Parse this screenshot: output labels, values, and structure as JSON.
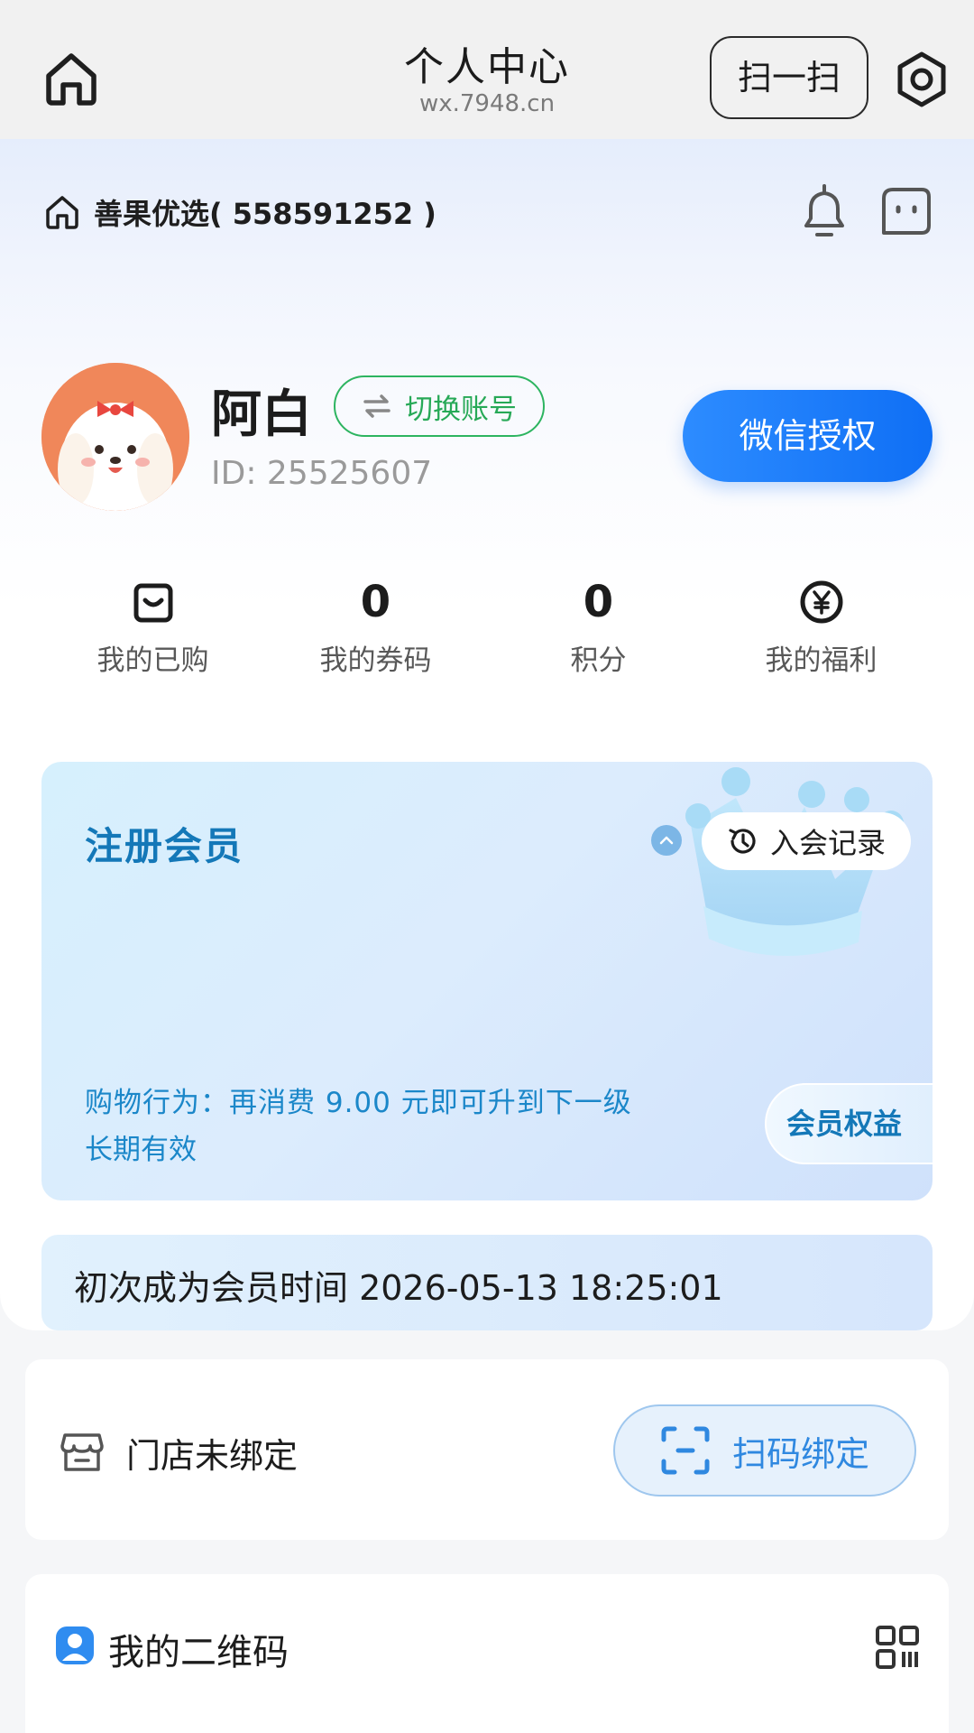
{
  "header": {
    "title": "个人中心",
    "subtitle": "wx.7948.cn",
    "scan_label": "扫一扫"
  },
  "store": {
    "name": "善果优选( 558591252 )"
  },
  "profile": {
    "username": "阿白",
    "switch_label": "切换账号",
    "user_id": "ID: 25525607",
    "wechat_auth_label": "微信授权"
  },
  "stats": {
    "items": [
      {
        "value": "",
        "label": "我的已购",
        "icon": "shopping-bag-icon"
      },
      {
        "value": "0",
        "label": "我的券码"
      },
      {
        "value": "0",
        "label": "积分"
      },
      {
        "value": "",
        "label": "我的福利",
        "icon": "yen-coin-icon"
      }
    ]
  },
  "member_card": {
    "title": "注册会员",
    "record_label": "入会记录",
    "line1": "购物行为：再消费 9.00 元即可升到下一级",
    "line2": "长期有效",
    "benefits_label": "会员权益"
  },
  "first_member": {
    "text": "初次成为会员时间 2026-05-13 18:25:01"
  },
  "store_binding": {
    "status_label": "门店未绑定",
    "scan_bind_label": "扫码绑定"
  },
  "qr_section": {
    "label": "我的二维码"
  },
  "colors": {
    "accent_blue": "#1478b8",
    "wechat_btn": "#1677ff",
    "switch_green": "#27a957",
    "bind_blue": "#2f88e0"
  }
}
